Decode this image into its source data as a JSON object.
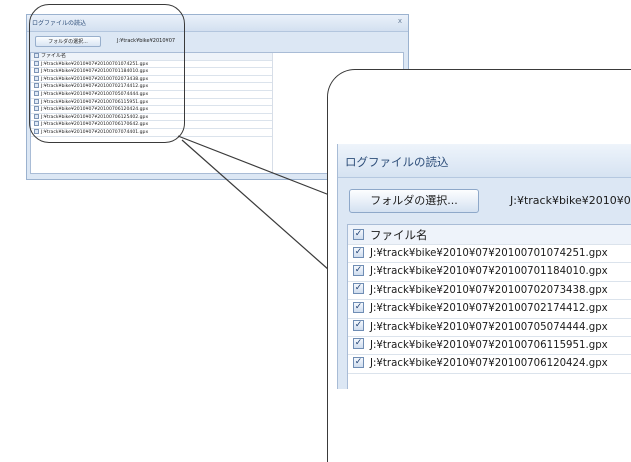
{
  "dialog": {
    "title": "ログファイルの読込",
    "folder_button_label": "フォルダの選択...",
    "folder_path_small": "J:¥track¥bike¥2010¥07",
    "folder_path_zoom": "J:¥track¥bike¥2010¥0",
    "close_glyph": "x"
  },
  "file_list": {
    "header": "ファイル名",
    "files": [
      "J:¥track¥bike¥2010¥07¥20100701074251.gpx",
      "J:¥track¥bike¥2010¥07¥20100701184010.gpx",
      "J:¥track¥bike¥2010¥07¥20100702073438.gpx",
      "J:¥track¥bike¥2010¥07¥20100702174412.gpx",
      "J:¥track¥bike¥2010¥07¥20100705074444.gpx",
      "J:¥track¥bike¥2010¥07¥20100706115951.gpx",
      "J:¥track¥bike¥2010¥07¥20100706120424.gpx",
      "J:¥track¥bike¥2010¥07¥20100706125402.gpx",
      "J:¥track¥bike¥2010¥07¥20100706170642.gpx",
      "J:¥track¥bike¥2010¥07¥20100707074401.gpx"
    ],
    "all_checked": true
  },
  "colors": {
    "window_bg": "#dce7f4",
    "title_text": "#2f4f7a",
    "ok_button": "#f3b43c",
    "callout_line": "#3a3a3a"
  }
}
